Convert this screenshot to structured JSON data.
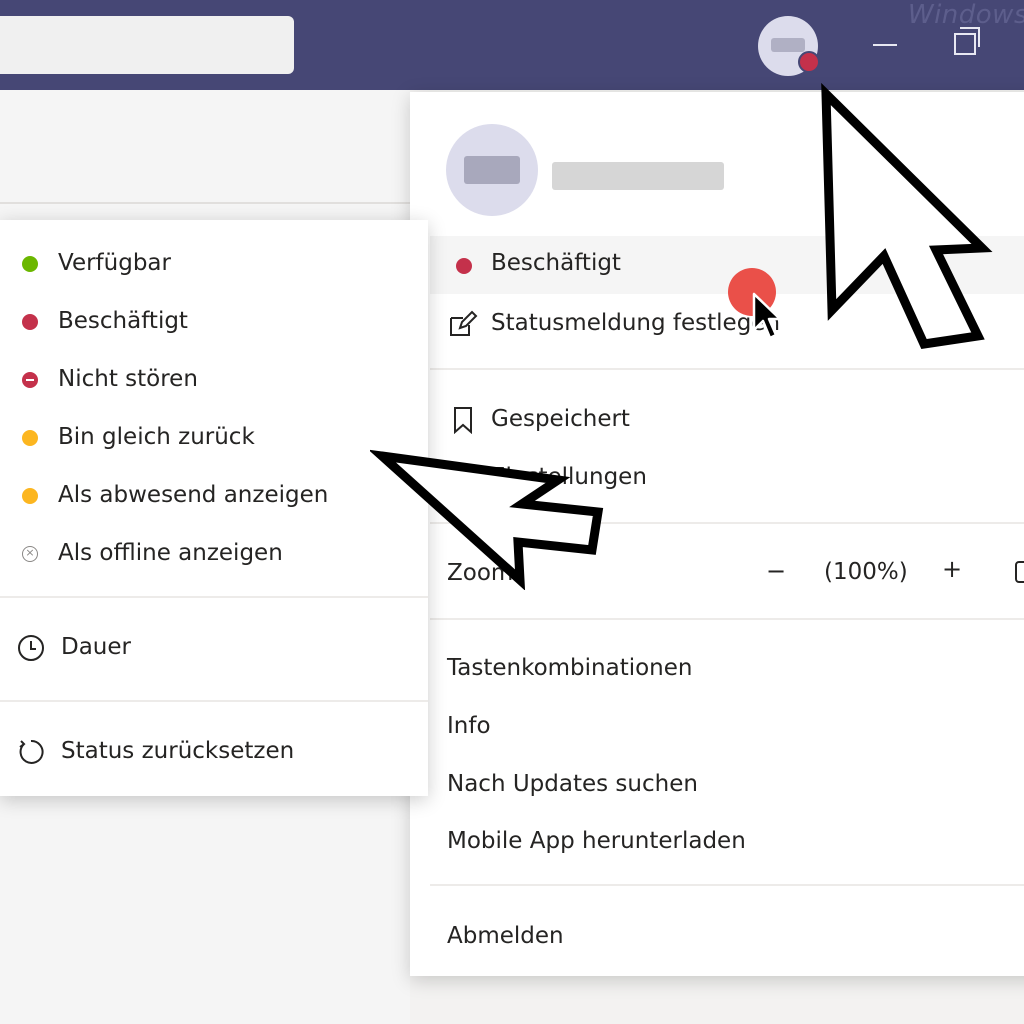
{
  "titlebar": {
    "watermark": "Windows",
    "search_placeholder": ""
  },
  "profile_menu": {
    "current_status": "Beschäftigt",
    "set_status_message": "Statusmeldung festlegen",
    "saved": "Gespeichert",
    "settings": "Einstellungen",
    "zoom_label": "Zoom",
    "zoom_out": "−",
    "zoom_value": "(100%)",
    "zoom_in": "+",
    "shortcuts": "Tastenkombinationen",
    "info": "Info",
    "check_updates": "Nach Updates suchen",
    "mobile_app": "Mobile App herunterladen",
    "sign_out": "Abmelden"
  },
  "status_menu": {
    "items": [
      {
        "label": "Verfügbar",
        "color": "#6bb700"
      },
      {
        "label": "Beschäftigt",
        "color": "#c4314b"
      },
      {
        "label": "Nicht stören",
        "color": "#c4314b"
      },
      {
        "label": "Bin gleich zurück",
        "color": "#fcb620"
      },
      {
        "label": "Als abwesend anzeigen",
        "color": "#fcb620"
      },
      {
        "label": "Als offline anzeigen",
        "color": "#8a8886"
      }
    ],
    "duration": "Dauer",
    "reset_status": "Status zurücksetzen"
  },
  "colors": {
    "titlebar": "#464775",
    "busy": "#c4314b",
    "available": "#6bb700",
    "away": "#fcb620",
    "click_marker": "#e8413a"
  }
}
